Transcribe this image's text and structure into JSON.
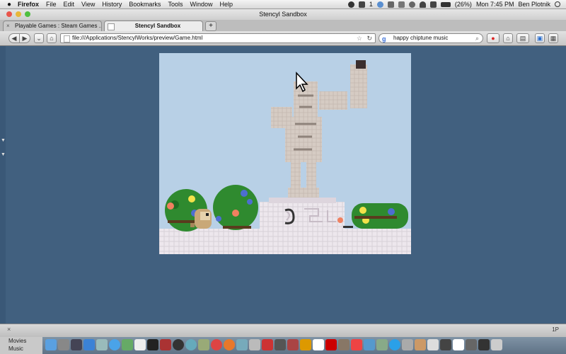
{
  "menubar": {
    "apple": "",
    "app_name": "Firefox",
    "menus": [
      "File",
      "Edit",
      "View",
      "History",
      "Bookmarks",
      "Tools",
      "Window",
      "Help"
    ],
    "battery": "(26%)",
    "clock": "Mon 7:45 PM",
    "user": "Ben Plotnik",
    "status_number": "1"
  },
  "window": {
    "title": "Stencyl Sandbox",
    "tabs": [
      {
        "label": "Playable Games : Steam Games ..."
      },
      {
        "label": "Stencyl Sandbox"
      }
    ],
    "new_tab_label": "+",
    "url": "file:///Applications/StencylWorks/preview/Game.html",
    "search_query": "happy chiptune music",
    "statusbar_right": "1P"
  },
  "dock": {
    "side_items": [
      "Movies",
      "Music"
    ]
  },
  "colors": {
    "desktop": "#41607f",
    "sky": "#b8d0e6",
    "ground": "#ece6ec",
    "bush": "#2f8a2f",
    "statue": "#d3c8c0"
  }
}
